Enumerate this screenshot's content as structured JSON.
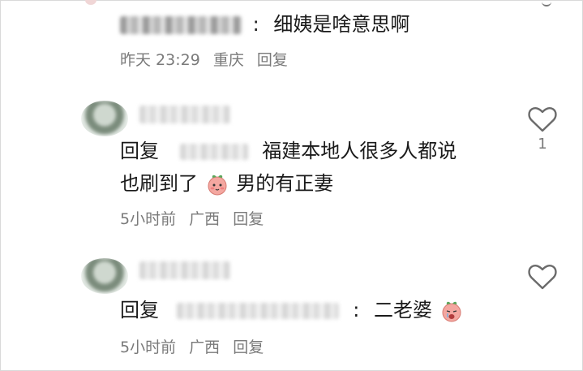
{
  "comments": [
    {
      "reply_prefix": "",
      "content": "细姨是啥意思啊",
      "time": "昨天 23:29",
      "location": "重庆",
      "reply_label": "回复"
    },
    {
      "reply_prefix": "回复",
      "content_line1": "福建本地人很多人都说",
      "content_line2_a": "也刷到了",
      "content_line2_b": "男的有正妻",
      "time": "5小时前",
      "location": "广西",
      "reply_label": "回复",
      "like_count": "1"
    },
    {
      "reply_prefix": "回复",
      "content": "二老婆",
      "time": "5小时前",
      "location": "广西",
      "reply_label": "回复"
    }
  ],
  "punctuation": {
    "colon": ":"
  },
  "icons": {
    "like": "heart-outline-icon",
    "emoji": "peach-face-emoji-icon"
  },
  "colors": {
    "text": "#1a1a1a",
    "meta": "#7a7a7a",
    "icon": "#6b6b6b",
    "emoji_face": "#f4a7a0"
  }
}
